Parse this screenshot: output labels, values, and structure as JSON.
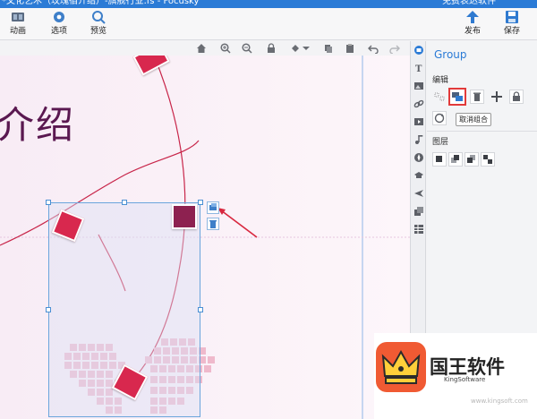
{
  "window": {
    "title": "*文化艺术（玫瑰宿介绍）-旗舰行业.fs - Focusky",
    "right_text": "免费表达软件"
  },
  "toolbar": {
    "animation_label": "动画",
    "options_label": "选项",
    "preview_label": "预览",
    "publish_label": "发布",
    "save_label": "保存"
  },
  "canvas": {
    "title_text": "介绍"
  },
  "panel": {
    "title": "Group",
    "edit_section": "编辑",
    "ungroup_tooltip": "取消组合",
    "layer_section": "图层"
  },
  "watermark": {
    "brand": "国王软件",
    "subtitle": "KingSoftware",
    "site": "www.kingsoft.com"
  },
  "colors": {
    "accent": "#2b7bd6",
    "highlight": "#e23a3a",
    "photo_red": "#d8284e",
    "curve": "#c8264a"
  }
}
